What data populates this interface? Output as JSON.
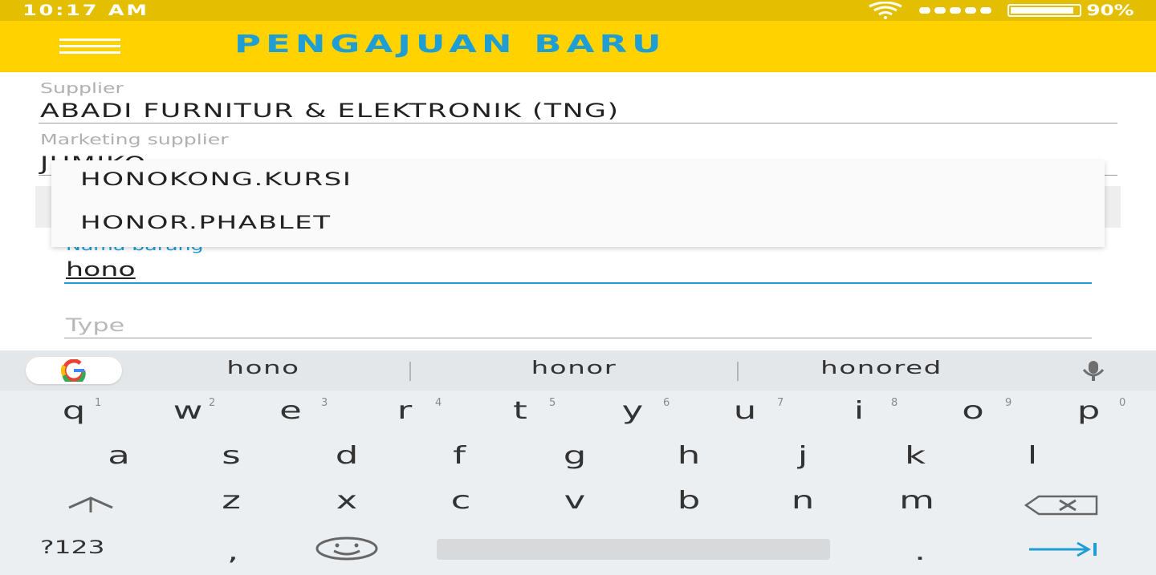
{
  "status_bar": {
    "time": "10:17 AM",
    "battery": "90%",
    "icons": [
      "wifi-icon",
      "signal-icon",
      "battery-icon"
    ]
  },
  "app_bar": {
    "title": "PENGAJUAN BARU",
    "menu_icon": "hamburger-menu-icon"
  },
  "form": {
    "supplier_label": "Supplier",
    "supplier_value": "ABADI FURNITUR  & ELEKTRONIK (TNG)",
    "marketing_label": "Marketing supplier",
    "marketing_value": "JUMIKO",
    "nama_barang_label": "Nama barang",
    "nama_barang_value": "hono",
    "type_placeholder": "Type"
  },
  "autocomplete": {
    "items": [
      "HONOKONG.KURSI",
      "HONOR.PHABLET"
    ]
  },
  "keyboard": {
    "suggestions": [
      "hono",
      "honor",
      "honored"
    ],
    "row1": [
      "q",
      "w",
      "e",
      "r",
      "t",
      "y",
      "u",
      "i",
      "o",
      "p"
    ],
    "row1_hints": [
      "1",
      "2",
      "3",
      "4",
      "5",
      "6",
      "7",
      "8",
      "9",
      "0"
    ],
    "row2": [
      "a",
      "s",
      "d",
      "f",
      "g",
      "h",
      "j",
      "k",
      "l"
    ],
    "row3": [
      "z",
      "x",
      "c",
      "v",
      "b",
      "n",
      "m"
    ],
    "symbols_key": "?123",
    "comma_key": ",",
    "period_key": ".",
    "colors": {
      "accent": "#1e9ed4",
      "app_bar": "#ffd200",
      "status_bar": "#e4be00"
    }
  }
}
